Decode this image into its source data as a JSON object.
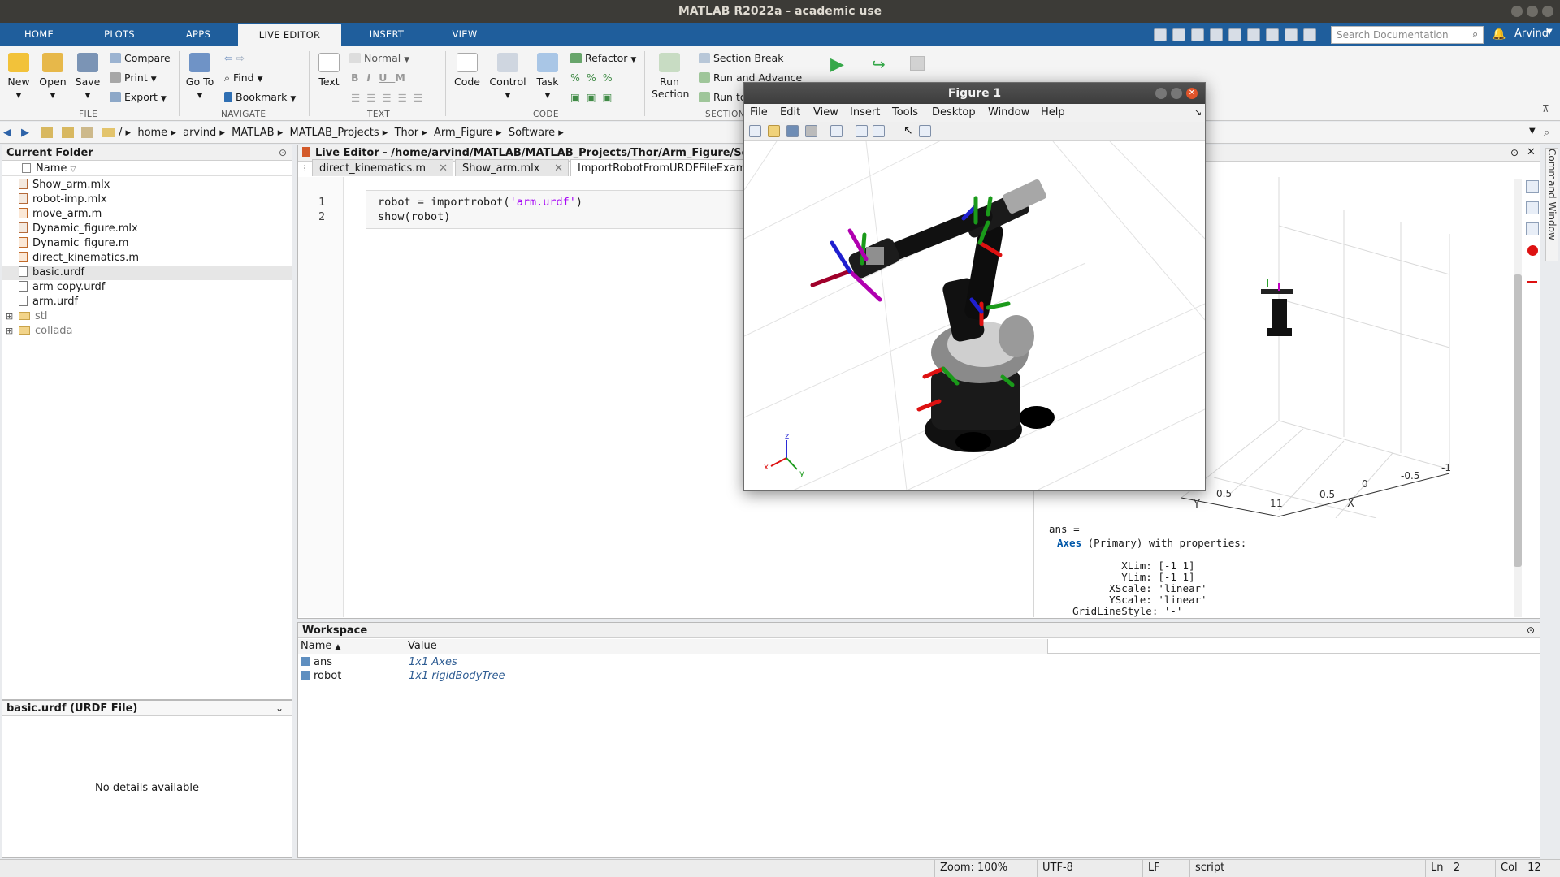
{
  "window": {
    "title": "MATLAB R2022a - academic use"
  },
  "tabs": [
    {
      "label": "HOME"
    },
    {
      "label": "PLOTS"
    },
    {
      "label": "APPS"
    },
    {
      "label": "LIVE EDITOR"
    },
    {
      "label": "INSERT"
    },
    {
      "label": "VIEW"
    }
  ],
  "search": {
    "placeholder": "Search Documentation"
  },
  "user": {
    "name": "Arvind"
  },
  "ribbon": {
    "file": {
      "new": "New",
      "open": "Open",
      "save": "Save",
      "compare": "Compare",
      "print": "Print",
      "export": "Export",
      "label": "FILE"
    },
    "navigate": {
      "goto": "Go To",
      "find": "Find",
      "bookmark": "Bookmark",
      "label": "NAVIGATE"
    },
    "text": {
      "style": "Normal",
      "text": "Text",
      "label": "TEXT",
      "bold": "B",
      "italic": "I",
      "underline": "U",
      "mono": "M"
    },
    "code": {
      "code": "Code",
      "control": "Control",
      "task": "Task",
      "refactor": "Refactor",
      "label": "CODE"
    },
    "section": {
      "run_section": "Run Section",
      "section_break": "Section Break",
      "run_advance": "Run and Advance",
      "run_to": "Run to",
      "label": "SECTION"
    }
  },
  "breadcrumb": [
    "/",
    "home",
    "arvind",
    "MATLAB",
    "MATLAB_Projects",
    "Thor",
    "Arm_Figure",
    "Software"
  ],
  "current_folder": {
    "title": "Current Folder",
    "column": "Name",
    "files": [
      {
        "name": "Show_arm.mlx",
        "type": "mlx"
      },
      {
        "name": "robot-imp.mlx",
        "type": "mlx"
      },
      {
        "name": "move_arm.m",
        "type": "m"
      },
      {
        "name": "Dynamic_figure.mlx",
        "type": "mlx"
      },
      {
        "name": "Dynamic_figure.m",
        "type": "m"
      },
      {
        "name": "direct_kinematics.m",
        "type": "m"
      },
      {
        "name": "basic.urdf",
        "type": "file"
      },
      {
        "name": "arm copy.urdf",
        "type": "file"
      },
      {
        "name": "arm.urdf",
        "type": "file"
      },
      {
        "name": "stl",
        "type": "folder"
      },
      {
        "name": "collada",
        "type": "folder"
      }
    ]
  },
  "details": {
    "title": "basic.urdf  (URDF File)",
    "message": "No details available"
  },
  "editor": {
    "title": "Live Editor - /home/arvind/MATLAB/MATLAB_Projects/Thor/Arm_Figure/Softw",
    "tabs": [
      "direct_kinematics.m",
      "Show_arm.mlx",
      "ImportRobotFromURDFFileExampl"
    ],
    "lines": [
      {
        "num": "1",
        "pre": "robot = importrobot(",
        "str": "'arm.urdf'",
        "post": ")"
      },
      {
        "num": "2",
        "pre": "show(robot)",
        "str": "",
        "post": ""
      }
    ]
  },
  "output": {
    "ans": "ans =",
    "axes_link": "Axes",
    "axes_rest": " (Primary) with properties:",
    "props": [
      "        XLim: [-1 1]",
      "        YLim: [-1 1]",
      "      XScale: 'linear'",
      "      YScale: 'linear'",
      "GridLineStyle: '-'"
    ],
    "axis_x": "X",
    "axis_y": "Y",
    "ticks": [
      "0.5",
      "1",
      "1",
      "0.5",
      "0",
      "-0.5",
      "-1"
    ]
  },
  "figure": {
    "title": "Figure 1",
    "menu": [
      "File",
      "Edit",
      "View",
      "Insert",
      "Tools",
      "Desktop",
      "Window",
      "Help"
    ],
    "triad": {
      "x": "x",
      "y": "y",
      "z": "z"
    }
  },
  "workspace": {
    "title": "Workspace",
    "columns": [
      "Name",
      "Value"
    ],
    "rows": [
      {
        "name": "ans",
        "value": "1x1 Axes"
      },
      {
        "name": "robot",
        "value": "1x1 rigidBodyTree"
      }
    ]
  },
  "command_window": {
    "label": "Command Window"
  },
  "status": {
    "zoom": "Zoom: 100%",
    "encoding": "UTF-8",
    "eol": "LF",
    "mode": "script",
    "ln_label": "Ln",
    "ln": "2",
    "col_label": "Col",
    "col": "12"
  },
  "colors": {
    "accent": "#1f5e9c",
    "string": "#a709f5",
    "link": "#0057a8"
  }
}
